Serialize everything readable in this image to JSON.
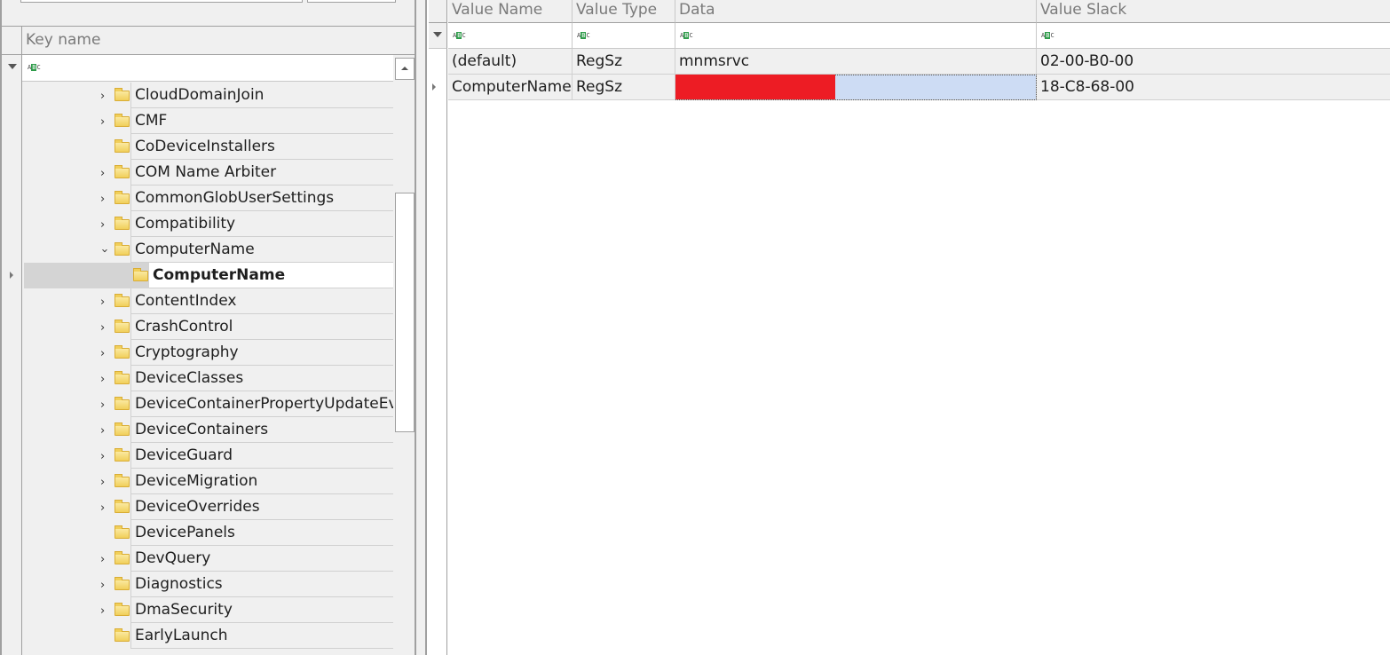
{
  "left": {
    "header": "Key name",
    "tree": [
      {
        "label": "CloudDomainJoin",
        "expander": "collapsed"
      },
      {
        "label": "CMF",
        "expander": "collapsed"
      },
      {
        "label": "CoDeviceInstallers",
        "expander": "none"
      },
      {
        "label": "COM Name Arbiter",
        "expander": "collapsed"
      },
      {
        "label": "CommonGlobUserSettings",
        "expander": "collapsed"
      },
      {
        "label": "Compatibility",
        "expander": "collapsed"
      },
      {
        "label": "ComputerName",
        "expander": "expanded"
      },
      {
        "label": "ComputerName",
        "expander": "none",
        "child": true,
        "selected": true
      },
      {
        "label": "ContentIndex",
        "expander": "collapsed"
      },
      {
        "label": "CrashControl",
        "expander": "collapsed"
      },
      {
        "label": "Cryptography",
        "expander": "collapsed"
      },
      {
        "label": "DeviceClasses",
        "expander": "collapsed"
      },
      {
        "label": "DeviceContainerPropertyUpdateEvents",
        "expander": "collapsed"
      },
      {
        "label": "DeviceContainers",
        "expander": "collapsed"
      },
      {
        "label": "DeviceGuard",
        "expander": "collapsed"
      },
      {
        "label": "DeviceMigration",
        "expander": "collapsed"
      },
      {
        "label": "DeviceOverrides",
        "expander": "collapsed"
      },
      {
        "label": "DevicePanels",
        "expander": "none"
      },
      {
        "label": "DevQuery",
        "expander": "collapsed"
      },
      {
        "label": "Diagnostics",
        "expander": "collapsed"
      },
      {
        "label": "DmaSecurity",
        "expander": "collapsed"
      },
      {
        "label": "EarlyLaunch",
        "expander": "none"
      }
    ]
  },
  "right": {
    "columns": [
      "Value Name",
      "Value Type",
      "Data",
      "Value Slack"
    ],
    "rows": [
      {
        "name": "(default)",
        "type": "RegSz",
        "data": "mnmsrvc",
        "slack": "02-00-B0-00"
      },
      {
        "name": "ComputerName",
        "type": "RegSz",
        "data": "",
        "slack": "18-C8-68-00",
        "redacted": true,
        "focused": true
      }
    ]
  },
  "colors": {
    "redaction": "#ed1c24",
    "selection": "#cddcf4",
    "filter_icon": "#2e9b4a",
    "folder": "#f1cf5a"
  }
}
